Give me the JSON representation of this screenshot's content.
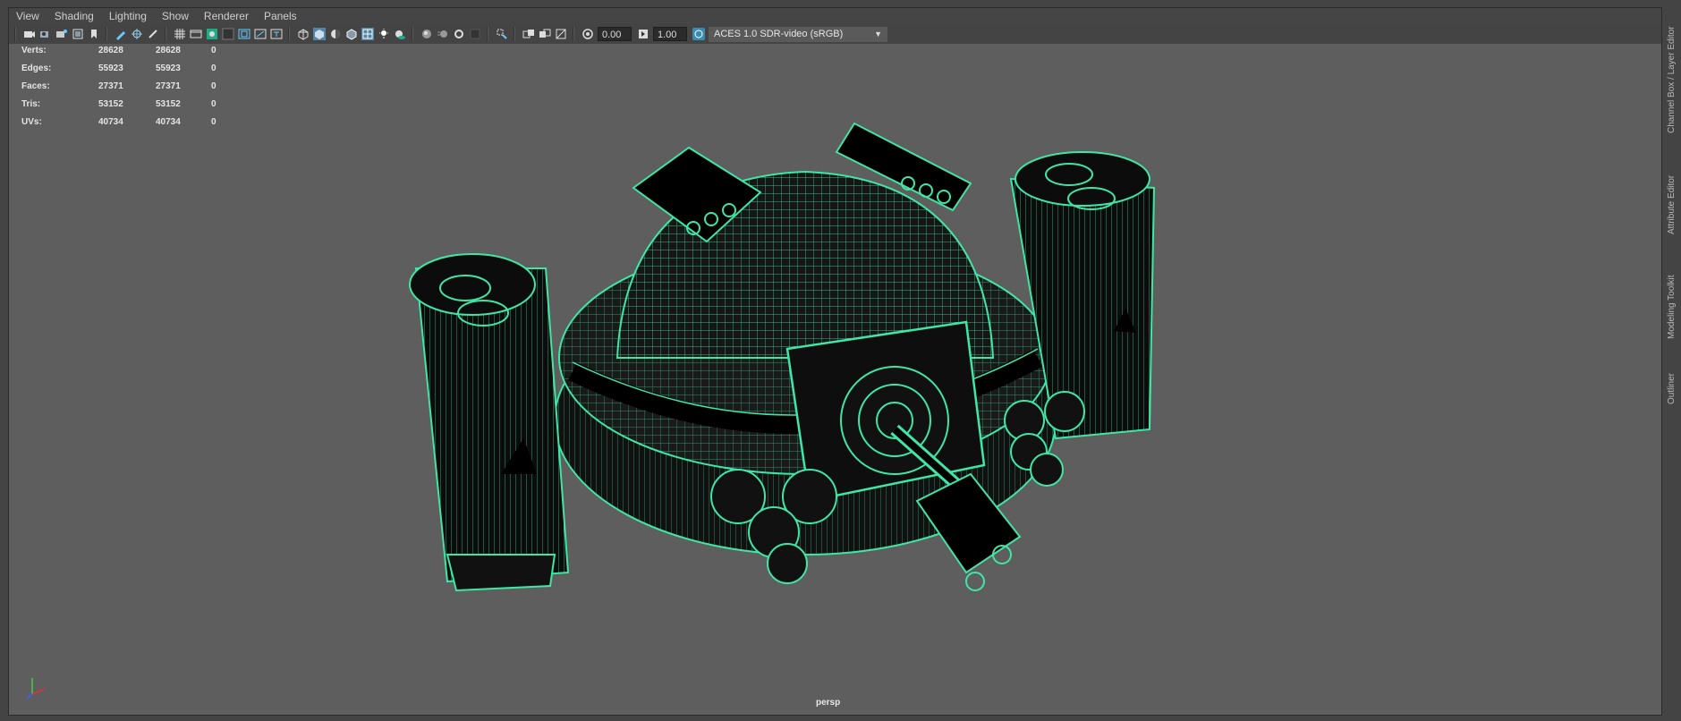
{
  "menu": [
    "View",
    "Shading",
    "Lighting",
    "Show",
    "Renderer",
    "Panels"
  ],
  "toolbar": {
    "exposure": "0.00",
    "gamma": "1.00",
    "color_space": "ACES 1.0 SDR-video (sRGB)"
  },
  "hud": {
    "rows": [
      {
        "label": "Verts:",
        "a": "28628",
        "b": "28628",
        "c": "0"
      },
      {
        "label": "Edges:",
        "a": "55923",
        "b": "55923",
        "c": "0"
      },
      {
        "label": "Faces:",
        "a": "27371",
        "b": "27371",
        "c": "0"
      },
      {
        "label": "Tris:",
        "a": "53152",
        "b": "53152",
        "c": "0"
      },
      {
        "label": "UVs:",
        "a": "40734",
        "b": "40734",
        "c": "0"
      }
    ]
  },
  "camera_label": "persp",
  "side_tabs": [
    "Channel Box / Layer Editor",
    "Attribute Editor",
    "Modeling Toolkit",
    "Outliner"
  ],
  "colors": {
    "wireframe": "#3fe6a8",
    "viewport_bg": "#5e5e5e",
    "panel_bg": "#444444"
  }
}
